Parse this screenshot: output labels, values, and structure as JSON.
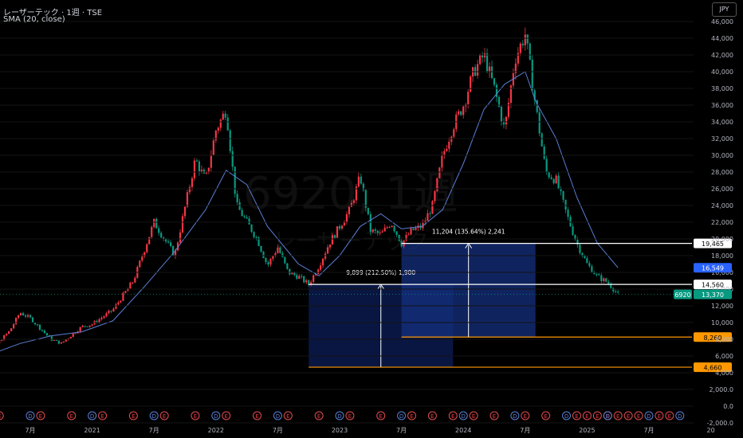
{
  "header": {
    "title": "レーザーテック · 1週 · TSE",
    "indicator": "SMA (20, close)"
  },
  "currency_button": "JPY",
  "watermark": {
    "symbol": "6920, 1週",
    "name": "レーザーテック"
  },
  "colors": {
    "background": "#000000",
    "up": "#f23645",
    "down": "#089981",
    "sma": "#5b7fd6",
    "box": "#0e1f5e",
    "orange": "#ff9800",
    "blue_badge": "#2962ff",
    "green_badge": "#089981"
  },
  "chart_data": {
    "type": "candlestick",
    "timeframe": "1週",
    "y_axis": {
      "range": [
        -2000,
        46000
      ],
      "ticks": [
        "46,000",
        "44,000",
        "42,000",
        "40,000",
        "38,000",
        "36,000",
        "34,000",
        "32,000",
        "30,000",
        "28,000",
        "26,000",
        "24,000",
        "22,000",
        "20,000",
        "18,000",
        "16,000",
        "14,000",
        "12,000",
        "10,000",
        "8,000",
        "6,000",
        "4,000",
        "2,000.0",
        "0.0",
        "-2,000.0"
      ]
    },
    "x_axis": {
      "ticks": [
        "7月",
        "2021",
        "7月",
        "2022",
        "7月",
        "2023",
        "7月",
        "2024",
        "7月",
        "2025",
        "7月",
        "20"
      ]
    },
    "price_path": [
      [
        "2020-01",
        5000
      ],
      [
        "2020-03",
        6500
      ],
      [
        "2020-05",
        9000
      ],
      [
        "2020-06",
        11200
      ],
      [
        "2020-07",
        10500
      ],
      [
        "2020-09",
        8000
      ],
      [
        "2020-10",
        7500
      ],
      [
        "2020-12",
        9500
      ],
      [
        "2021-01",
        9800
      ],
      [
        "2021-03",
        11500
      ],
      [
        "2021-05",
        15000
      ],
      [
        "2021-06",
        18500
      ],
      [
        "2021-07",
        22000
      ],
      [
        "2021-08",
        20000
      ],
      [
        "2021-09",
        18000
      ],
      [
        "2021-11",
        29500
      ],
      [
        "2021-12",
        27000
      ],
      [
        "2022-01",
        33000
      ],
      [
        "2022-02",
        35500
      ],
      [
        "2022-03",
        24000
      ],
      [
        "2022-05",
        20000
      ],
      [
        "2022-06",
        16800
      ],
      [
        "2022-07",
        19000
      ],
      [
        "2022-08",
        16000
      ],
      [
        "2022-09",
        15500
      ],
      [
        "2022-10",
        14560
      ],
      [
        "2022-11",
        16800
      ],
      [
        "2022-12",
        19500
      ],
      [
        "2023-01",
        21500
      ],
      [
        "2023-02",
        23500
      ],
      [
        "2023-03",
        27500
      ],
      [
        "2023-04",
        21000
      ],
      [
        "2023-05",
        20500
      ],
      [
        "2023-06",
        22000
      ],
      [
        "2023-07",
        19465
      ],
      [
        "2023-08",
        21000
      ],
      [
        "2023-09",
        21500
      ],
      [
        "2023-10",
        24000
      ],
      [
        "2023-11",
        30000
      ],
      [
        "2023-12",
        33500
      ],
      [
        "2024-01",
        36000
      ],
      [
        "2024-02",
        40000
      ],
      [
        "2024-03",
        42000
      ],
      [
        "2024-04",
        38000
      ],
      [
        "2024-05",
        33000
      ],
      [
        "2024-06",
        41500
      ],
      [
        "2024-07",
        44500
      ],
      [
        "2024-08",
        36000
      ],
      [
        "2024-09",
        28000
      ],
      [
        "2024-10",
        27000
      ],
      [
        "2024-11",
        23000
      ],
      [
        "2024-12",
        19500
      ],
      [
        "2025-01",
        17000
      ],
      [
        "2025-02",
        15500
      ],
      [
        "2025-03",
        14800
      ],
      [
        "2025-04",
        13370
      ]
    ],
    "sma": {
      "name": "SMA (20, close)",
      "points": [
        [
          "2020-01",
          5200
        ],
        [
          "2020-06",
          7500
        ],
        [
          "2020-09",
          8400
        ],
        [
          "2020-12",
          8900
        ],
        [
          "2021-03",
          10200
        ],
        [
          "2021-06",
          14200
        ],
        [
          "2021-09",
          18500
        ],
        [
          "2021-12",
          23500
        ],
        [
          "2022-02",
          28200
        ],
        [
          "2022-04",
          26500
        ],
        [
          "2022-06",
          21500
        ],
        [
          "2022-09",
          17000
        ],
        [
          "2022-11",
          15600
        ],
        [
          "2023-01",
          18000
        ],
        [
          "2023-03",
          21500
        ],
        [
          "2023-05",
          23000
        ],
        [
          "2023-07",
          21200
        ],
        [
          "2023-09",
          21500
        ],
        [
          "2023-11",
          23500
        ],
        [
          "2024-01",
          29000
        ],
        [
          "2024-03",
          35500
        ],
        [
          "2024-05",
          38500
        ],
        [
          "2024-07",
          40000
        ],
        [
          "2024-08",
          36500
        ],
        [
          "2024-10",
          32000
        ],
        [
          "2024-12",
          25000
        ],
        [
          "2025-02",
          19500
        ],
        [
          "2025-04",
          16549
        ]
      ]
    },
    "horizontal_lines": [
      {
        "price": 19465,
        "label": "19,465",
        "color": "#ffffff"
      },
      {
        "price": 14560,
        "label": "14,560",
        "color": "#ffffff"
      },
      {
        "price": 8260,
        "label": "8,260",
        "color": "#ff9800"
      },
      {
        "price": 4660,
        "label": "4,660",
        "color": "#ff9800"
      }
    ],
    "price_badges": [
      {
        "price": 16549,
        "label": "16,549",
        "color": "#2962ff"
      },
      {
        "price": 13370,
        "label": "13,370",
        "symbol": "6920",
        "color": "#089981"
      }
    ],
    "measurements": [
      {
        "from_date": "2022-10",
        "to_date": "2023-12",
        "from_price": 4660,
        "to_price": 14560,
        "label": "9,899 (212.50%) 1,980"
      },
      {
        "from_date": "2023-07",
        "to_date": "2024-08",
        "from_price": 8260,
        "to_price": 19465,
        "label": "11,204 (135.64%) 2,241"
      }
    ],
    "event_markers": {
      "row": [
        "E",
        "D",
        "E",
        "E",
        "D",
        "E",
        "E",
        "D",
        "E",
        "E",
        "D",
        "E",
        "E",
        "D",
        "E",
        "E",
        "D",
        "E",
        "E",
        "D",
        "E",
        "E",
        "E",
        "D",
        "E",
        "E",
        "D",
        "E",
        "E",
        "D",
        "E",
        "E",
        "E",
        "E",
        "D",
        "E",
        "E",
        "E",
        "D",
        "E",
        "E",
        "D"
      ],
      "dates": [
        "2020-04",
        "2020-07",
        "2020-08",
        "2020-11",
        "2021-01",
        "2021-02",
        "2021-05",
        "2021-07",
        "2021-08",
        "2021-11",
        "2022-01",
        "2022-02",
        "2022-05",
        "2022-07",
        "2022-08",
        "2022-11",
        "2023-01",
        "2023-02",
        "2023-05",
        "2023-07",
        "2023-08",
        "2023-10",
        "2023-12",
        "2024-01",
        "2024-02",
        "2024-04",
        "2024-06",
        "2024-07",
        "2024-09",
        "2024-11",
        "2024-12",
        "2025-01",
        "2025-02",
        "2025-03",
        "2025-03",
        "2025-04",
        "2025-05",
        "2025-06",
        "2025-07",
        "2025-08",
        "2025-09",
        "2025-10"
      ]
    }
  }
}
